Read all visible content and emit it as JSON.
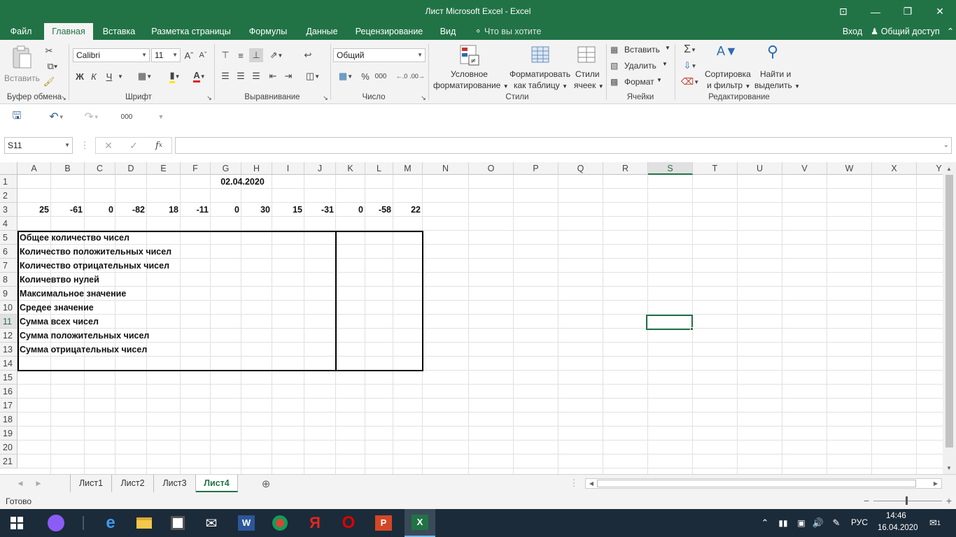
{
  "window": {
    "title": "Лист Microsoft Excel - Excel",
    "controls": {
      "restore_ribbon": "⊡",
      "minimize": "—",
      "maximize": "❐",
      "close": "✕"
    }
  },
  "ribbon_tabs": [
    "Файл",
    "Главная",
    "Вставка",
    "Разметка страницы",
    "Формулы",
    "Данные",
    "Рецензирование",
    "Вид"
  ],
  "tell_me": "Что вы хотите сделать?",
  "signin": "Вход",
  "share": "Общий доступ",
  "clipboard": {
    "paste": "Вставить",
    "group": "Буфер обмена"
  },
  "font": {
    "name": "Calibri",
    "size": "11",
    "bold": "Ж",
    "italic": "К",
    "underline": "Ч",
    "group": "Шрифт"
  },
  "alignment": {
    "group": "Выравнивание"
  },
  "number": {
    "format": "Общий",
    "percent": "%",
    "thousands": "000",
    "group": "Число"
  },
  "styles": {
    "cond1": "Условное",
    "cond2": "форматирование",
    "table1": "Форматировать",
    "table2": "как таблицу",
    "cell1": "Стили",
    "cell2": "ячеек",
    "group": "Стили"
  },
  "cells": {
    "insert": "Вставить",
    "delete": "Удалить",
    "format": "Формат",
    "group": "Ячейки"
  },
  "editing": {
    "sort1": "Сортировка",
    "sort2": "и фильтр",
    "find1": "Найти и",
    "find2": "выделить",
    "group": "Редактирование"
  },
  "qat": {
    "extra": "000"
  },
  "namebox": "S11",
  "formula_value": "",
  "columns": [
    "A",
    "B",
    "C",
    "D",
    "E",
    "F",
    "G",
    "H",
    "I",
    "J",
    "K",
    "L",
    "M",
    "N",
    "O",
    "P",
    "Q",
    "R",
    "S",
    "T",
    "U",
    "V",
    "W",
    "X",
    "Y"
  ],
  "rows": [
    "1",
    "2",
    "3",
    "4",
    "5",
    "6",
    "7",
    "8",
    "9",
    "10",
    "11",
    "12",
    "13",
    "14",
    "15",
    "16",
    "17",
    "18",
    "19",
    "20",
    "21"
  ],
  "sheet": {
    "date": "02.04.2020",
    "numbers": [
      "25",
      "-61",
      "0",
      "-82",
      "18",
      "-11",
      "0",
      "30",
      "15",
      "-31",
      "0",
      "-58",
      "22"
    ],
    "labels": [
      "Общее количество чисел",
      "Количество положительных чисел",
      "Количество отрицательных чисел",
      "Количевтво нулей",
      "Максимальное значение",
      "Средее значение",
      "Сумма всех чисел",
      "Сумма положительных чисел",
      "Сумма отрицательных чисел"
    ]
  },
  "sheet_tabs": [
    "Лист1",
    "Лист2",
    "Лист3",
    "Лист4"
  ],
  "active_sheet": "Лист4",
  "status": "Готово",
  "taskbar": {
    "lang": "РУС",
    "time": "14:46",
    "date": "16.04.2020",
    "notif": "1"
  },
  "colors": {
    "brand": "#217346",
    "taskbar": "#1c2b39"
  }
}
